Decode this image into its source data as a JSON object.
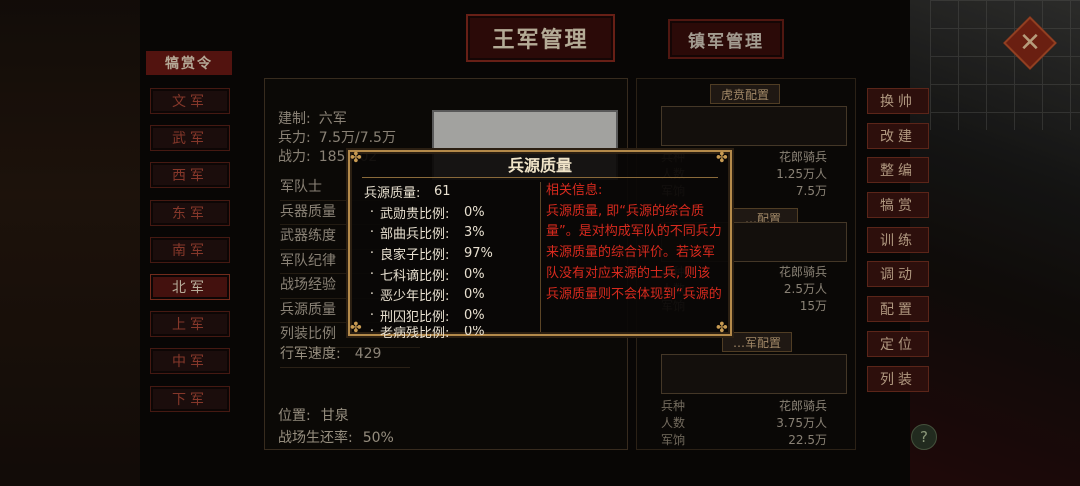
{
  "header": {
    "tabs": [
      {
        "label": "王军管理",
        "active": true
      },
      {
        "label": "镇军管理",
        "active": false
      }
    ]
  },
  "left_panel": {
    "title_badge": "犒赏令",
    "armies": [
      {
        "label": "文军",
        "active": false
      },
      {
        "label": "武军",
        "active": false
      },
      {
        "label": "西军",
        "active": false
      },
      {
        "label": "东军",
        "active": false
      },
      {
        "label": "南军",
        "active": false
      },
      {
        "label": "北军",
        "active": true
      },
      {
        "label": "上军",
        "active": false
      },
      {
        "label": "中军",
        "active": false
      },
      {
        "label": "下军",
        "active": false
      }
    ]
  },
  "army_stats": {
    "system_label": "建制:",
    "system_value": "六军",
    "troops_label": "兵力:",
    "troops_value": "7.5万/7.5万",
    "power_label": "战力:",
    "power_value": "185…02"
  },
  "attributes": [
    "军队士",
    "兵器质量",
    "武器练度",
    "军队纪律",
    "战场经验",
    "兵源质量",
    "列装比例"
  ],
  "march_speed": {
    "label": "行军速度:",
    "value": "429"
  },
  "location": {
    "label": "位置:",
    "value": "甘泉",
    "survival_label": "战场生还率:",
    "survival_value": "50%"
  },
  "sub_armies": [
    {
      "header": "虎贲配置",
      "type_label": "兵种",
      "type": "花郎骑兵",
      "count_label": "人数",
      "count": "1.25万人",
      "pay_label": "军饷",
      "pay": "7.5万"
    },
    {
      "header": "…配置",
      "type_label": "兵种",
      "type": "花郎骑兵",
      "count_label": "人数",
      "count": "2.5万人",
      "pay_label": "军饷",
      "pay": "15万"
    },
    {
      "header": "…军配置",
      "type_label": "兵种",
      "type": "花郎骑兵",
      "count_label": "人数",
      "count": "3.75万人",
      "pay_label": "军饷",
      "pay": "22.5万"
    }
  ],
  "right_menu": [
    "换帅",
    "改建",
    "整编",
    "犒赏",
    "训练",
    "调动",
    "配置",
    "定位",
    "列装"
  ],
  "popup": {
    "title": "兵源质量",
    "headline_label": "兵源质量:",
    "headline_value": "61",
    "rows": [
      {
        "label": "武勋贵比例:",
        "value": "0%"
      },
      {
        "label": "部曲兵比例:",
        "value": "3%"
      },
      {
        "label": "良家子比例:",
        "value": "97%"
      },
      {
        "label": "七科谪比例:",
        "value": "0%"
      },
      {
        "label": "恶少年比例:",
        "value": "0%"
      },
      {
        "label": "刑囚犯比例:",
        "value": "0%"
      },
      {
        "label": "老病残比例:",
        "value": "0%"
      }
    ],
    "info_title": "相关信息:",
    "info_text": "兵源质量, 即“兵源的综合质量”。是对构成军队的不同兵力来源质量的综合评价。若该军队没有对应来源的士兵, 则该兵源质量则不会体现到“兵源的"
  },
  "colors": {
    "accent_red": "#d82a1e",
    "gold_border": "#b48a4a",
    "button_red": "#3d1411"
  },
  "icons": {
    "close": "close-icon",
    "help": "help-icon"
  }
}
